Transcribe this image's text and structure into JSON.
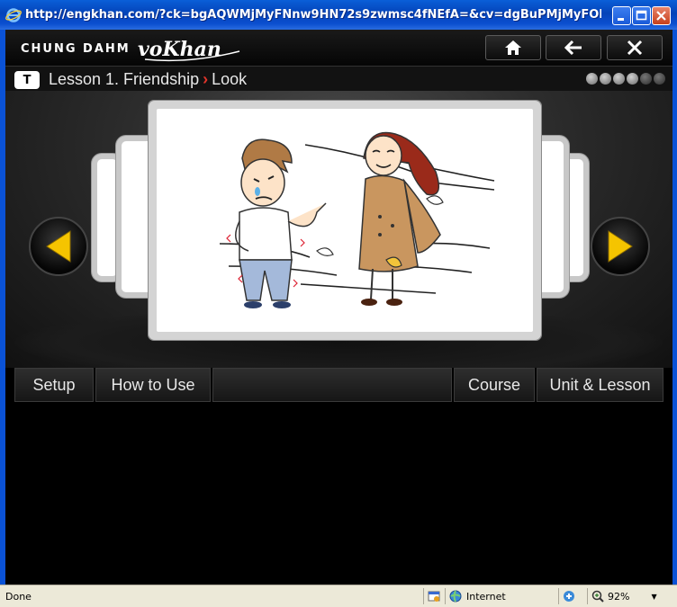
{
  "window": {
    "title": "http://engkhan.com/?ck=bgAQWMjMyFNnw9HN72s9zwmsc4fNEfA=&cv=dgBuPMjMyFOKaKqoSo5HAoO..."
  },
  "header": {
    "brand_text": "CHUNG DAHM",
    "logo_text": "voKhan"
  },
  "lesson": {
    "badge": "T",
    "title": "Lesson 1. Friendship",
    "separator": "›",
    "section": "Look"
  },
  "menu": {
    "setup": "Setup",
    "how_to_use": "How to Use",
    "course": "Course",
    "unit_lesson": "Unit & Lesson"
  },
  "status": {
    "text": "Done",
    "zone": "Internet",
    "zoom": "92%"
  },
  "colors": {
    "arrow_yellow": "#f5c400",
    "accent_red": "#e0342a",
    "xp_blue": "#0a52d6"
  }
}
